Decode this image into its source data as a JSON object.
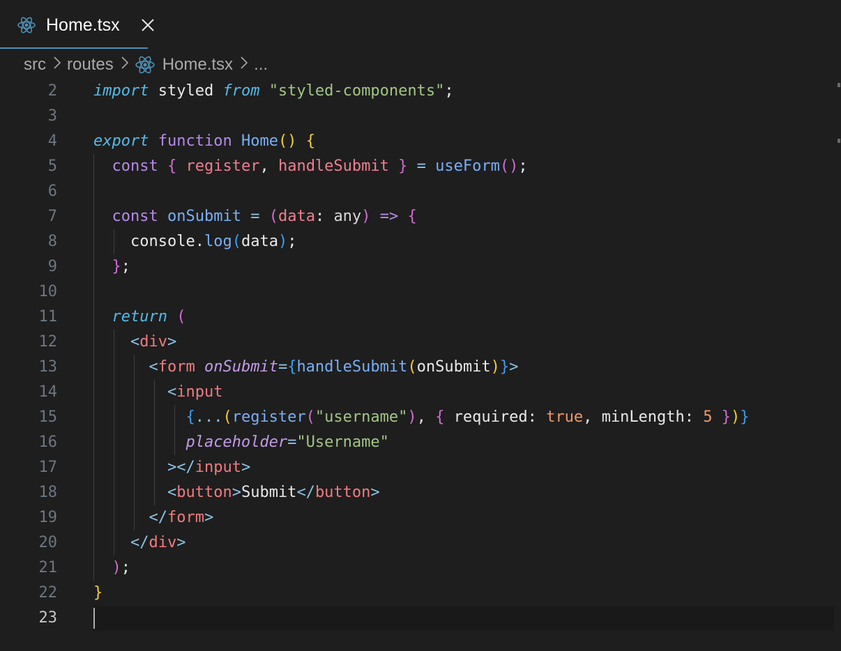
{
  "tab": {
    "label": "Home.tsx",
    "close": "✕",
    "icon": "react-icon"
  },
  "breadcrumb": {
    "items": [
      "src",
      "routes",
      "Home.tsx",
      "..."
    ],
    "separator": ">"
  },
  "editor": {
    "active_line": 23,
    "lines": [
      {
        "n": 2,
        "tokens": [
          [
            "kw-it",
            "import"
          ],
          [
            "plain",
            " styled "
          ],
          [
            "kw-it",
            "from"
          ],
          [
            "plain",
            " "
          ],
          [
            "str",
            "\"styled-components\""
          ],
          [
            "plain",
            ";"
          ]
        ]
      },
      {
        "n": 3,
        "tokens": []
      },
      {
        "n": 4,
        "tokens": [
          [
            "kw-it",
            "export"
          ],
          [
            "plain",
            " "
          ],
          [
            "kw",
            "function"
          ],
          [
            "plain",
            " "
          ],
          [
            "fn",
            "Home"
          ],
          [
            "b1",
            "()"
          ],
          [
            "plain",
            " "
          ],
          [
            "b1",
            "{"
          ]
        ]
      },
      {
        "n": 5,
        "tokens": [
          [
            "plain",
            "  "
          ],
          [
            "kw",
            "const"
          ],
          [
            "plain",
            " "
          ],
          [
            "b2",
            "{"
          ],
          [
            "plain",
            " "
          ],
          [
            "param",
            "register"
          ],
          [
            "plain",
            ", "
          ],
          [
            "param",
            "handleSubmit"
          ],
          [
            "plain",
            " "
          ],
          [
            "b2",
            "}"
          ],
          [
            "plain",
            " "
          ],
          [
            "pun",
            "="
          ],
          [
            "plain",
            " "
          ],
          [
            "fn",
            "useForm"
          ],
          [
            "b2",
            "()"
          ],
          [
            "plain",
            ";"
          ]
        ]
      },
      {
        "n": 6,
        "tokens": []
      },
      {
        "n": 7,
        "tokens": [
          [
            "plain",
            "  "
          ],
          [
            "kw",
            "const"
          ],
          [
            "plain",
            " "
          ],
          [
            "fn",
            "onSubmit"
          ],
          [
            "plain",
            " "
          ],
          [
            "pun",
            "="
          ],
          [
            "plain",
            " "
          ],
          [
            "b2",
            "("
          ],
          [
            "param",
            "data"
          ],
          [
            "plain",
            ": "
          ],
          [
            "type",
            "any"
          ],
          [
            "b2",
            ")"
          ],
          [
            "plain",
            " "
          ],
          [
            "kw",
            "=>"
          ],
          [
            "plain",
            " "
          ],
          [
            "b2",
            "{"
          ]
        ]
      },
      {
        "n": 8,
        "tokens": [
          [
            "plain",
            "    "
          ],
          [
            "var",
            "console"
          ],
          [
            "plain",
            "."
          ],
          [
            "fn",
            "log"
          ],
          [
            "b3",
            "("
          ],
          [
            "var",
            "data"
          ],
          [
            "b3",
            ")"
          ],
          [
            "plain",
            ";"
          ]
        ]
      },
      {
        "n": 9,
        "tokens": [
          [
            "plain",
            "  "
          ],
          [
            "b2",
            "}"
          ],
          [
            "plain",
            ";"
          ]
        ]
      },
      {
        "n": 10,
        "tokens": []
      },
      {
        "n": 11,
        "tokens": [
          [
            "plain",
            "  "
          ],
          [
            "kw-it",
            "return"
          ],
          [
            "plain",
            " "
          ],
          [
            "b2",
            "("
          ]
        ]
      },
      {
        "n": 12,
        "tokens": [
          [
            "plain",
            "    "
          ],
          [
            "pun",
            "<"
          ],
          [
            "tag",
            "div"
          ],
          [
            "pun",
            ">"
          ]
        ]
      },
      {
        "n": 13,
        "tokens": [
          [
            "plain",
            "      "
          ],
          [
            "pun",
            "<"
          ],
          [
            "tag",
            "form"
          ],
          [
            "plain",
            " "
          ],
          [
            "attr",
            "onSubmit"
          ],
          [
            "pun",
            "="
          ],
          [
            "b3",
            "{"
          ],
          [
            "fn",
            "handleSubmit"
          ],
          [
            "b1",
            "("
          ],
          [
            "var",
            "onSubmit"
          ],
          [
            "b1",
            ")"
          ],
          [
            "b3",
            "}"
          ],
          [
            "pun",
            ">"
          ]
        ]
      },
      {
        "n": 14,
        "tokens": [
          [
            "plain",
            "        "
          ],
          [
            "pun",
            "<"
          ],
          [
            "tag",
            "input"
          ]
        ]
      },
      {
        "n": 15,
        "tokens": [
          [
            "plain",
            "          "
          ],
          [
            "b3",
            "{"
          ],
          [
            "pun",
            "..."
          ],
          [
            "b1",
            "("
          ],
          [
            "fn",
            "register"
          ],
          [
            "b2",
            "("
          ],
          [
            "str",
            "\"username\""
          ],
          [
            "b2",
            ")"
          ],
          [
            "plain",
            ", "
          ],
          [
            "b2",
            "{"
          ],
          [
            "plain",
            " "
          ],
          [
            "var",
            "required"
          ],
          [
            "plain",
            ": "
          ],
          [
            "num",
            "true"
          ],
          [
            "plain",
            ", "
          ],
          [
            "var",
            "minLength"
          ],
          [
            "plain",
            ": "
          ],
          [
            "num",
            "5"
          ],
          [
            "plain",
            " "
          ],
          [
            "b2",
            "}"
          ],
          [
            "b1",
            ")"
          ],
          [
            "b3",
            "}"
          ]
        ]
      },
      {
        "n": 16,
        "tokens": [
          [
            "plain",
            "          "
          ],
          [
            "attr",
            "placeholder"
          ],
          [
            "pun",
            "="
          ],
          [
            "str",
            "\"Username\""
          ]
        ]
      },
      {
        "n": 17,
        "tokens": [
          [
            "plain",
            "        "
          ],
          [
            "pun",
            "></"
          ],
          [
            "tag",
            "input"
          ],
          [
            "pun",
            ">"
          ]
        ]
      },
      {
        "n": 18,
        "tokens": [
          [
            "plain",
            "        "
          ],
          [
            "pun",
            "<"
          ],
          [
            "tag",
            "button"
          ],
          [
            "pun",
            ">"
          ],
          [
            "plain",
            "Submit"
          ],
          [
            "pun",
            "</"
          ],
          [
            "tag",
            "button"
          ],
          [
            "pun",
            ">"
          ]
        ]
      },
      {
        "n": 19,
        "tokens": [
          [
            "plain",
            "      "
          ],
          [
            "pun",
            "</"
          ],
          [
            "tag",
            "form"
          ],
          [
            "pun",
            ">"
          ]
        ]
      },
      {
        "n": 20,
        "tokens": [
          [
            "plain",
            "    "
          ],
          [
            "pun",
            "</"
          ],
          [
            "tag",
            "div"
          ],
          [
            "pun",
            ">"
          ]
        ]
      },
      {
        "n": 21,
        "tokens": [
          [
            "plain",
            "  "
          ],
          [
            "b2",
            ")"
          ],
          [
            "plain",
            ";"
          ]
        ]
      },
      {
        "n": 22,
        "tokens": [
          [
            "b1",
            "}"
          ]
        ]
      },
      {
        "n": 23,
        "tokens": []
      }
    ]
  },
  "colors": {
    "background": "#1e1e1e",
    "tab_underline": "#4d8fb5",
    "react_icon": "#4d8fb5"
  }
}
